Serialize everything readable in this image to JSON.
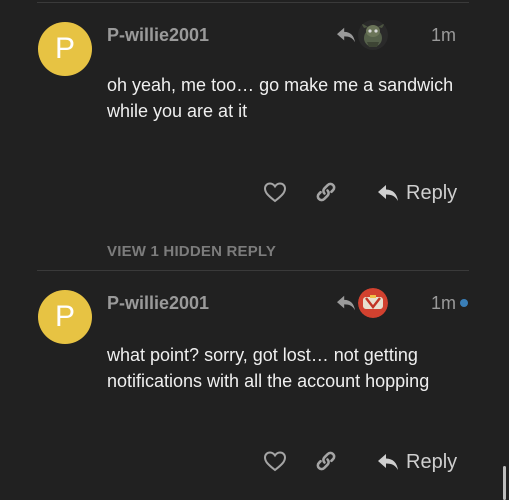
{
  "posts": [
    {
      "avatar_letter": "P",
      "username": "P-willie2001",
      "reply_to_avatar_icon": "gremlin-avatar",
      "time": "1m",
      "body": "oh yeah, me too… go make me a sandwich while you are at it",
      "reply_label": "Reply",
      "unread": false
    },
    {
      "avatar_letter": "P",
      "username": "P-willie2001",
      "reply_to_avatar_icon": "red-emblem-avatar",
      "time": "1m",
      "body": "what point? sorry, got lost… not getting notifications with all the account hopping",
      "reply_label": "Reply",
      "unread": true
    }
  ],
  "hidden_replies_label": "VIEW 1 HIDDEN REPLY",
  "colors": {
    "background": "#212121",
    "avatar": "#e7c343",
    "unread_dot": "#3a7fb8",
    "muted_text": "#9a9a9a"
  }
}
